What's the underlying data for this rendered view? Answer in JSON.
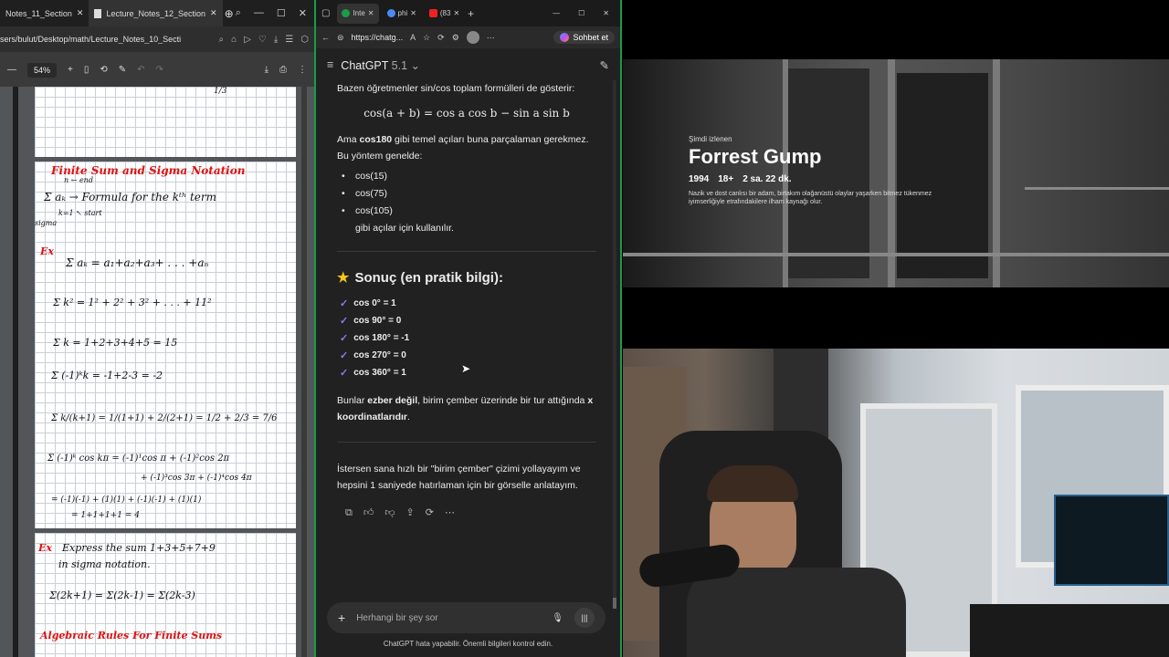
{
  "pdf_window": {
    "tabs": [
      {
        "label": "Notes_11_Section"
      },
      {
        "label": "Lecture_Notes_12_Section"
      }
    ],
    "address": "sers/bulut/Desktop/math/Lecture_Notes_10_Secti",
    "zoom": "54%",
    "page_top_fragment": "1/3",
    "notes": {
      "title": "Finite Sum and Sigma Notation",
      "end_label": "n ← end",
      "sigma_formula": "Σ aₖ → Formula for the kᵗʰ term",
      "start_label": "k=1  ↖ start",
      "sigma_word": "sigma",
      "ex_label": "Ex",
      "ex_line": "Σ aₖ = a₁+a₂+a₃+ . . . +aₙ",
      "line1": "Σ k² = 1² + 2² + 3² + . . . + 11²",
      "line2": "Σ k = 1+2+3+4+5 = 15",
      "line3": "Σ (-1)ᵏk = -1+2-3 = -2",
      "line4": "Σ k/(k+1) = 1/(1+1) + 2/(2+1) = 1/2 + 2/3 = 7/6",
      "line5a": "Σ (-1)ᵏ cos kπ = (-1)¹cos π + (-1)²cos 2π",
      "line5b": "+ (-1)³cos 3π + (-1)⁴cos 4π",
      "line6a": "= (-1)(-1) + (1)(1) + (-1)(-1) + (1)(1)",
      "line6b": "= 1+1+1+1 = 4",
      "ex2_label": "Ex",
      "ex2_text": "Express the sum 1+3+5+7+9",
      "ex2_text2": "in sigma notation.",
      "ex2_answer": "Σ(2k+1) = Σ(2k-1) = Σ(2k-3)",
      "next_title": "Algebraic Rules For Finite Sums"
    }
  },
  "chat_window": {
    "tabs": [
      {
        "label": "Inte"
      },
      {
        "label": "phi"
      },
      {
        "label": "(83"
      }
    ],
    "url": "https://chatg...",
    "sohbet_label": "Sohbet et",
    "model_name": "ChatGPT",
    "model_version": "5.1",
    "messages": {
      "intro": "Bazen öğretmenler sin/cos toplam formülleri de gösterir:",
      "formula": "cos(a + b) = cos a cos b − sin a sin b",
      "p2_prefix": "Ama ",
      "p2_bold": "cos180",
      "p2_suffix": " gibi temel açıları buna parçalaman gerekmez.",
      "p3": "Bu yöntem genelde:",
      "bullets": [
        "cos(15)",
        "cos(75)",
        "cos(105)"
      ],
      "bullet_tail": "gibi açılar için kullanılır.",
      "result_title": "Sonuç (en pratik bilgi):",
      "checks": [
        "cos 0° = 1",
        "cos 90° = 0",
        "cos 180° = -1",
        "cos 270° = 0",
        "cos 360° = 1"
      ],
      "p4_prefix": "Bunlar ",
      "p4_bold": "ezber değil",
      "p4_mid": ", birim çember üzerinde bir tur attığında ",
      "p4_bold2": "x koordinatlarıdır",
      "p4_end": ".",
      "p5": "İstersen sana hızlı bir \"birim çember\" çizimi yollayayım ve hepsini 1 saniyede hatırlaman için bir görselle anlatayım."
    },
    "input_placeholder": "Herhangi bir şey sor",
    "disclaimer": "ChatGPT hata yapabilir. Önemli bilgileri kontrol edin."
  },
  "movie": {
    "now_watching": "Şimdi izlenen",
    "title": "Forrest Gump",
    "year": "1994",
    "rating": "18+",
    "duration": "2 sa. 22 dk.",
    "description": "Nazik ve dost canlısı bir adam, birtakım olağanüstü olaylar yaşarken bitmez tükenmez iyimserliğiyle etrafındakilere ilham kaynağı olur."
  },
  "colors": {
    "chat_bg": "#212121",
    "accent_green": "#1a9c4a",
    "check": "#8a7cf0",
    "notes_red": "#dd1111"
  }
}
